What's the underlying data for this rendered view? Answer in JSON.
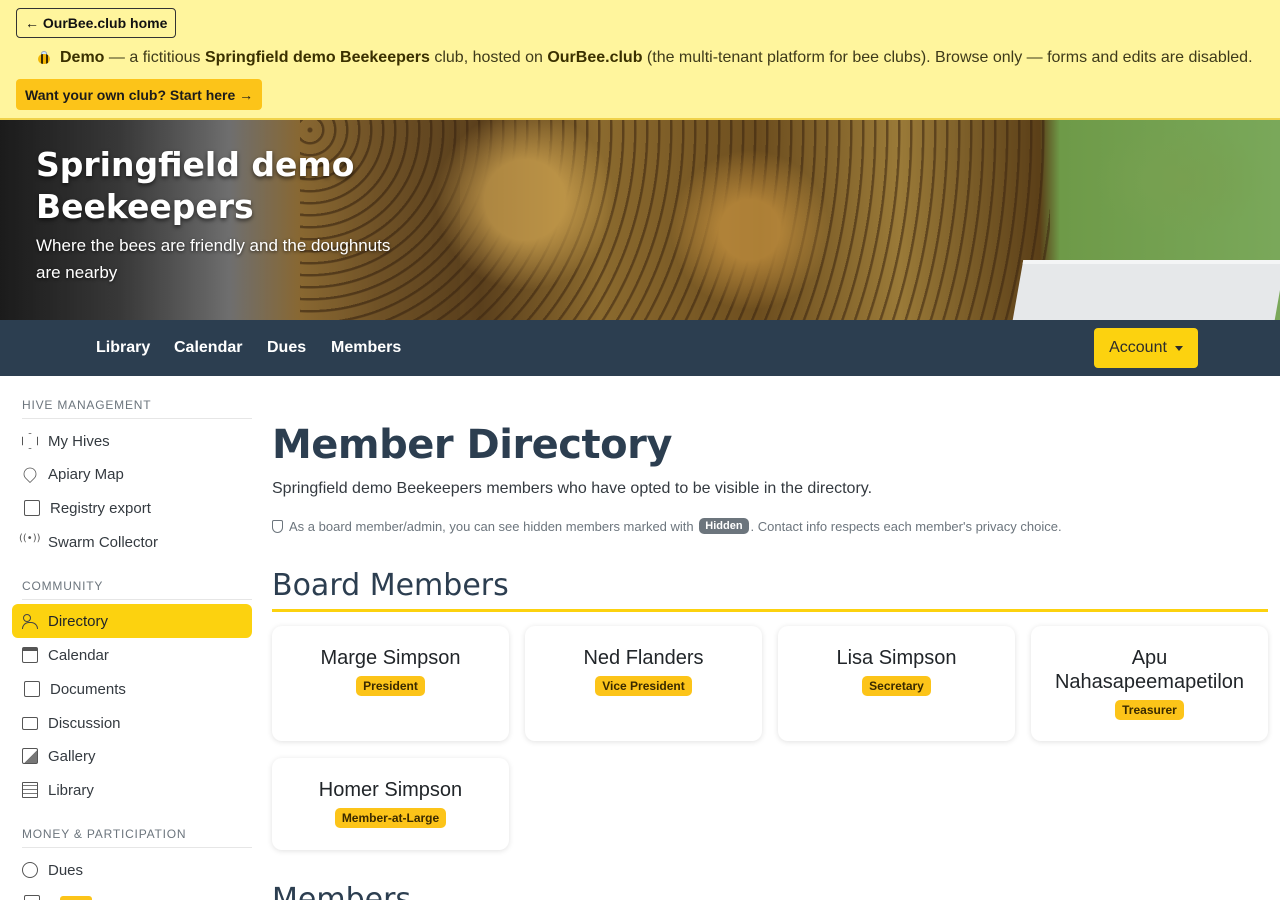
{
  "demo_banner": {
    "home_button": "← OurBee.club home",
    "demo_label": "Demo",
    "text_1": " — a fictitious ",
    "club_name": "Springfield demo Beekeepers",
    "text_2": " club, hosted on ",
    "platform": "OurBee.club",
    "text_3": " (the multi-tenant platform for bee clubs). Browse only — forms and edits are disabled.",
    "start_button": "Want your own club? Start here →"
  },
  "hero": {
    "title": "Springfield demo Beekeepers",
    "subtitle": "Where the bees are friendly and the doughnuts are nearby"
  },
  "navbar": {
    "links": [
      "Library",
      "Calendar",
      "Dues",
      "Members"
    ],
    "account_label": "Account"
  },
  "sidebar": {
    "sections": [
      {
        "heading": "HIVE MANAGEMENT",
        "items": [
          {
            "label": "My Hives",
            "icon": "hexagon-icon"
          },
          {
            "label": "Apiary Map",
            "icon": "map-pin-icon"
          },
          {
            "label": "Registry export",
            "icon": "document-icon"
          },
          {
            "label": "Swarm Collector",
            "icon": "broadcast-icon"
          }
        ]
      },
      {
        "heading": "COMMUNITY",
        "items": [
          {
            "label": "Directory",
            "icon": "people-icon",
            "active": true
          },
          {
            "label": "Calendar",
            "icon": "calendar-icon"
          },
          {
            "label": "Documents",
            "icon": "document-icon"
          },
          {
            "label": "Discussion",
            "icon": "chat-icon"
          },
          {
            "label": "Gallery",
            "icon": "image-icon"
          },
          {
            "label": "Library",
            "icon": "book-icon"
          }
        ]
      },
      {
        "heading": "MONEY & PARTICIPATION",
        "items": [
          {
            "label": "Dues",
            "icon": "dues-icon"
          }
        ]
      }
    ]
  },
  "main": {
    "title": "Member Directory",
    "lead": "Springfield demo Beekeepers members who have opted to be visible in the directory.",
    "admin_note_1": "As a board member/admin, you can see hidden members marked with",
    "hidden_badge": "Hidden",
    "admin_note_2": ". Contact info respects each member's privacy choice.",
    "board_title": "Board Members",
    "board": [
      {
        "name": "Marge Simpson",
        "role": "President"
      },
      {
        "name": "Ned Flanders",
        "role": "Vice President"
      },
      {
        "name": "Lisa Simpson",
        "role": "Secretary"
      },
      {
        "name": "Apu Nahasapeemapetilon",
        "role": "Treasurer"
      },
      {
        "name": "Homer Simpson",
        "role": "Member-at-Large"
      }
    ],
    "members_title": "Members"
  },
  "colors": {
    "banner_bg": "#fff59d",
    "accent": "#fcd20f",
    "navbar_bg": "#2c3e50",
    "heading": "#2c3e50"
  }
}
